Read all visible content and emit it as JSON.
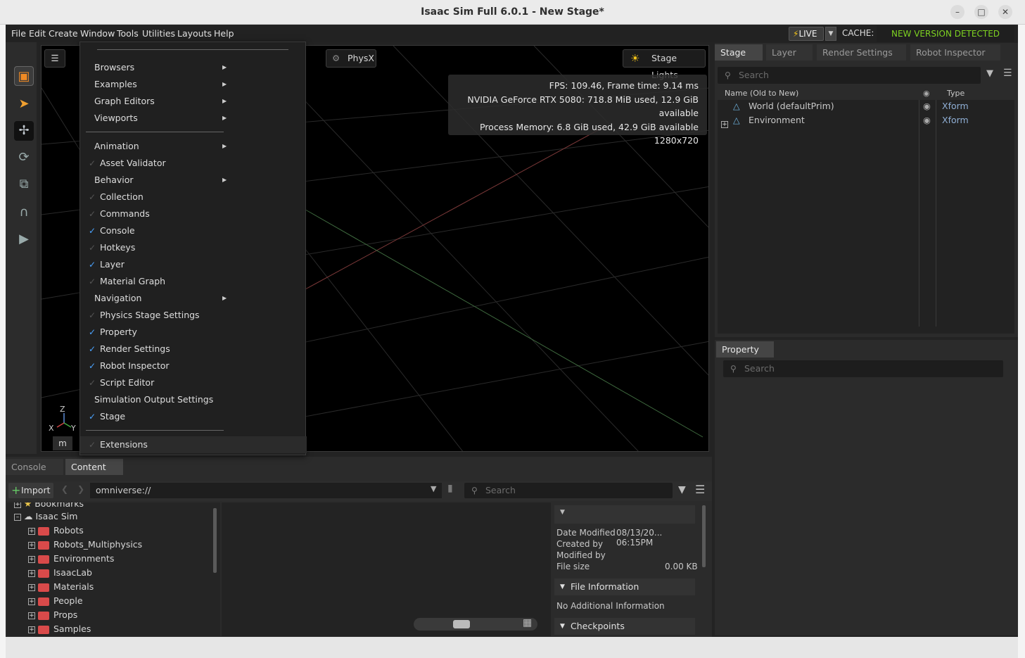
{
  "window": {
    "title": "Isaac Sim Full 6.0.1 - New Stage*"
  },
  "menubar": {
    "items": [
      "File",
      "Edit",
      "Create",
      "Window",
      "Tools",
      "Utilities",
      "Layouts",
      "Help"
    ]
  },
  "status": {
    "live": "LIVE",
    "cache": "CACHE:",
    "new_version": "NEW VERSION DETECTED"
  },
  "viewport": {
    "physx_label": "PhysX",
    "stage_lights_label": "Stage Lights",
    "stats": [
      "FPS: 109.46, Frame time: 9.14 ms",
      "NVIDIA GeForce RTX 5080: 718.8 MiB used, 12.9 GiB available",
      "Process Memory: 6.8 GiB used, 42.9 GiB available",
      "1280x720"
    ],
    "axis": {
      "z": "Z",
      "x": "X",
      "y": "Y"
    },
    "unit": "m"
  },
  "window_menu": {
    "items": [
      {
        "label": "Browsers",
        "submenu": true,
        "checked": null
      },
      {
        "label": "Examples",
        "submenu": true,
        "checked": null
      },
      {
        "label": "Graph Editors",
        "submenu": true,
        "checked": null
      },
      {
        "label": "Viewports",
        "submenu": true,
        "checked": null
      },
      {
        "label": "Animation",
        "submenu": true,
        "checked": null
      },
      {
        "label": "Asset Validator",
        "submenu": false,
        "checked": false
      },
      {
        "label": "Behavior",
        "submenu": true,
        "checked": null
      },
      {
        "label": "Collection",
        "submenu": false,
        "checked": false
      },
      {
        "label": "Commands",
        "submenu": false,
        "checked": false
      },
      {
        "label": "Console",
        "submenu": false,
        "checked": true
      },
      {
        "label": "Hotkeys",
        "submenu": false,
        "checked": false
      },
      {
        "label": "Layer",
        "submenu": false,
        "checked": true
      },
      {
        "label": "Material Graph",
        "submenu": false,
        "checked": false
      },
      {
        "label": "Navigation",
        "submenu": true,
        "checked": null
      },
      {
        "label": "Physics Stage Settings",
        "submenu": false,
        "checked": false
      },
      {
        "label": "Property",
        "submenu": false,
        "checked": true
      },
      {
        "label": "Render Settings",
        "submenu": false,
        "checked": true
      },
      {
        "label": "Robot Inspector",
        "submenu": false,
        "checked": true
      },
      {
        "label": "Script Editor",
        "submenu": false,
        "checked": false
      },
      {
        "label": "Simulation Output Settings",
        "submenu": false,
        "checked": null
      },
      {
        "label": "Stage",
        "submenu": false,
        "checked": true
      },
      {
        "label": "Extensions",
        "submenu": false,
        "checked": false
      }
    ]
  },
  "stage_panel": {
    "tabs": [
      "Stage",
      "Layer",
      "Render Settings",
      "Robot Inspector"
    ],
    "search_placeholder": "Search",
    "columns": {
      "name": "Name (Old to New)",
      "type": "Type"
    },
    "rows": [
      {
        "name": "World (defaultPrim)",
        "type": "Xform"
      },
      {
        "name": "Environment",
        "type": "Xform"
      }
    ]
  },
  "property_panel": {
    "tab": "Property",
    "search_placeholder": "Search"
  },
  "bottom": {
    "tabs": [
      "Console",
      "Content"
    ],
    "import_label": "Import",
    "path": "omniverse://",
    "search_placeholder": "Search",
    "tree": {
      "bookmarks": "Bookmarks",
      "root": "Isaac Sim",
      "folders": [
        "Robots",
        "Robots_Multiphysics",
        "Environments",
        "IsaacLab",
        "Materials",
        "People",
        "Props",
        "Samples"
      ]
    },
    "info": {
      "date_modified_label": "Date Modified",
      "date_modified_value": "08/13/20... 06:15PM",
      "created_by_label": "Created by",
      "modified_by_label": "Modified by",
      "file_size_label": "File size",
      "file_size_value": "0.00 KB",
      "file_information": "File Information",
      "no_info": "No Additional Information",
      "checkpoints": "Checkpoints"
    }
  }
}
